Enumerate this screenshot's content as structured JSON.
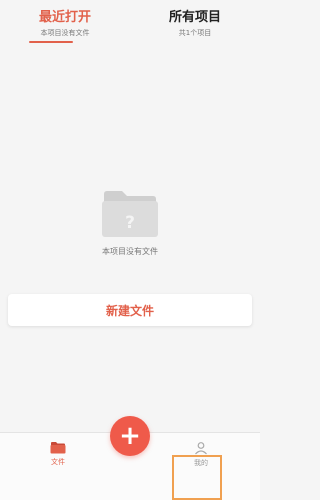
{
  "tabs": [
    {
      "title": "最近打开",
      "subtitle": "本项目没有文件"
    },
    {
      "title": "所有项目",
      "subtitle": "共1个项目"
    }
  ],
  "empty_state": {
    "icon": "folder-question-icon",
    "text": "本项目没有文件"
  },
  "new_file_button": {
    "label": "新建文件"
  },
  "fab": {
    "icon": "plus-icon",
    "symbol": "+"
  },
  "bottom_nav": {
    "items": [
      {
        "label": "文件",
        "icon": "folder-icon"
      },
      {
        "label": "我的",
        "icon": "user-icon"
      }
    ]
  },
  "colors": {
    "accent": "#e2614b",
    "fab": "#ef5a4a",
    "highlight": "#f0a050"
  }
}
